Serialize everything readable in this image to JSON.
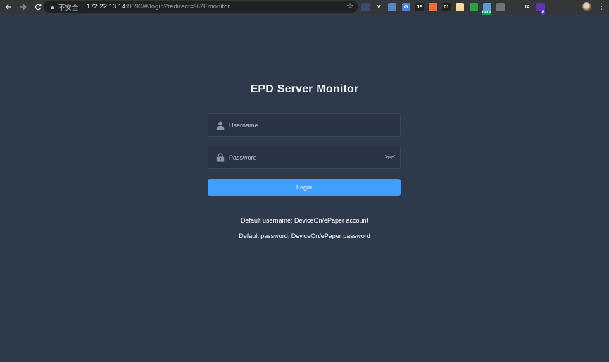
{
  "browser": {
    "warning_label": "不安全",
    "url_host": "172.22.13.14",
    "url_path": ":8090/#/login?redirect=%2Fmonitor",
    "extensions": [
      {
        "name": "ext-1",
        "text": "",
        "color": "#3c4a6e"
      },
      {
        "name": "ext-vue",
        "text": "V",
        "color": "#35363a"
      },
      {
        "name": "ext-3",
        "text": "",
        "color": "#5b84c4"
      },
      {
        "name": "ext-translate",
        "text": "G",
        "color": "#4a7fd4"
      },
      {
        "name": "ext-5",
        "text": "JF",
        "color": "#202124"
      },
      {
        "name": "ext-6",
        "text": "",
        "color": "#e8713c"
      },
      {
        "name": "ext-01",
        "text": "01",
        "color": "#202124"
      },
      {
        "name": "ext-8",
        "text": "",
        "color": "#f3d9a4"
      },
      {
        "name": "ext-download",
        "text": "",
        "color": "#2e9e44"
      },
      {
        "name": "ext-beta",
        "text": "",
        "color": "#5b9bd5",
        "badge": "beta"
      },
      {
        "name": "ext-11",
        "text": "",
        "color": "#6f7378"
      },
      {
        "name": "ext-12",
        "text": "",
        "color": "#35363a"
      },
      {
        "name": "ext-ia",
        "text": "IA",
        "color": "#35363a"
      },
      {
        "name": "ext-14",
        "text": "",
        "color": "#5e35b1",
        "badge": "8"
      },
      {
        "name": "ext-15",
        "text": "",
        "color": "#35363a"
      },
      {
        "name": "ext-puzzle",
        "text": "",
        "color": "#35363a"
      }
    ]
  },
  "login": {
    "title": "EPD Server Monitor",
    "username_placeholder": "Username",
    "password_placeholder": "Password",
    "login_label": "Login",
    "tip_username": "Default username: DeviceOn/ePaper account",
    "tip_password": "Default password: DeviceOn/ePaper password"
  },
  "colors": {
    "background": "#2d3a4b",
    "input_background": "#283443",
    "primary_button": "#409eff"
  }
}
